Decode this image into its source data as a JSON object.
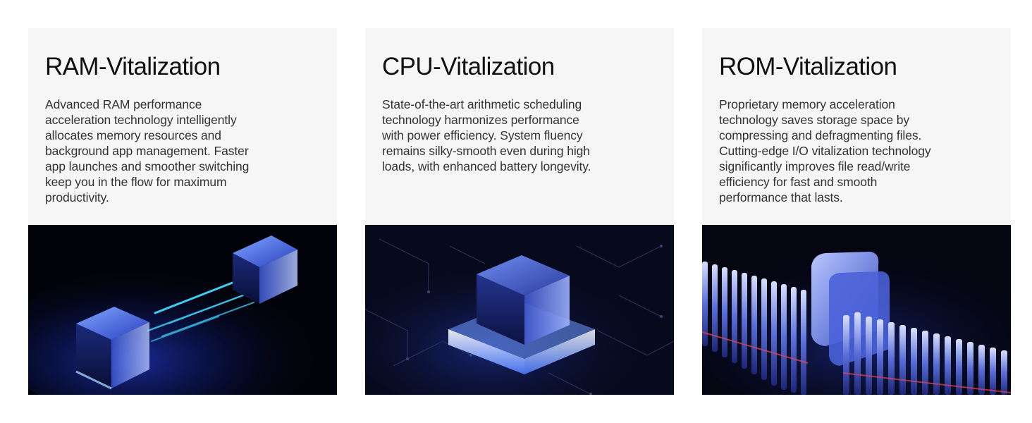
{
  "cards": [
    {
      "title": "RAM-Vitalization",
      "description": "Advanced RAM performance acceleration technology intelligently allocates memory resources and background app management. Faster app launches and smoother switching keep you in the flow for maximum productivity.",
      "illustration": "ram-data-transfer-illustration"
    },
    {
      "title": "CPU-Vitalization",
      "description": "State-of-the-art arithmetic scheduling technology harmonizes performance with power efficiency. System fluency remains silky-smooth even during high loads, with enhanced battery longevity.",
      "illustration": "cpu-chip-illustration"
    },
    {
      "title": "ROM-Vitalization",
      "description": "Proprietary memory acceleration technology saves storage space by compressing and defragmenting files. Cutting-edge I/O vitalization technology significantly improves file read/write efficiency for fast and smooth performance that lasts.",
      "illustration": "rom-storage-illustration"
    }
  ],
  "colors": {
    "card_background": "#f6f6f6",
    "media_background": "#03040c",
    "glow_blue": "#3b7bff",
    "cyan_beam": "#43d8ff"
  }
}
